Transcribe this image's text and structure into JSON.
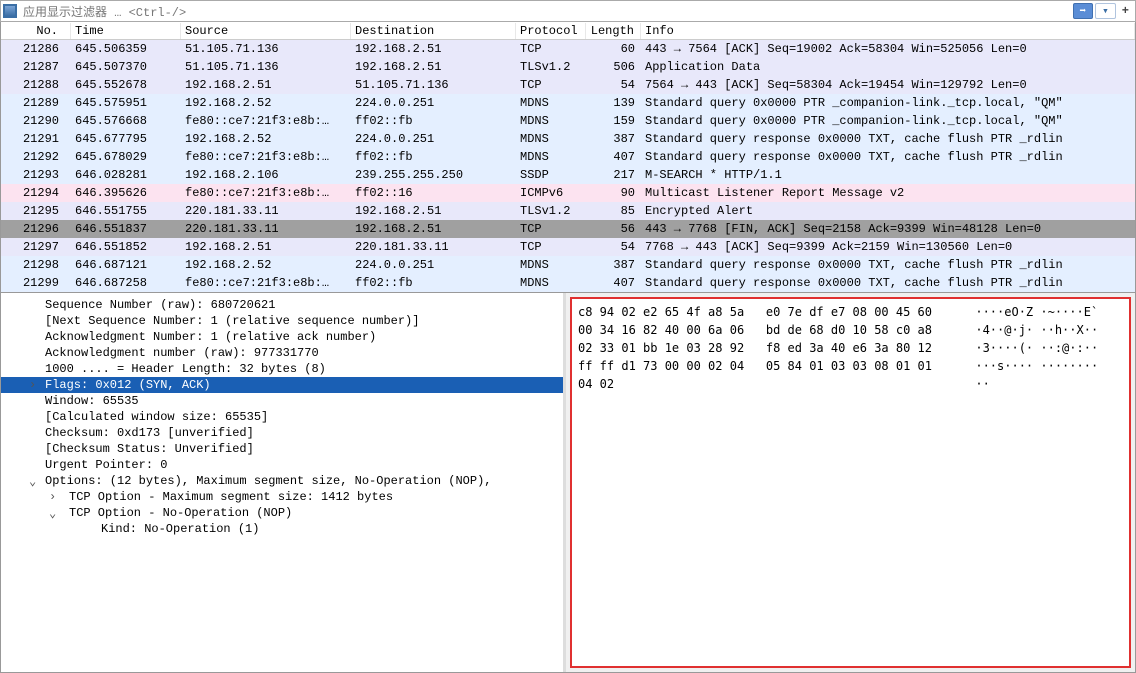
{
  "filter": {
    "placeholder": "应用显示过滤器 … <Ctrl-/>",
    "go_label": "➡",
    "add_label": "+"
  },
  "columns": {
    "no": "No.",
    "time": "Time",
    "source": "Source",
    "destination": "Destination",
    "protocol": "Protocol",
    "length": "Length",
    "info": "Info"
  },
  "packets": [
    {
      "no": "21286",
      "time": "645.506359",
      "src": "51.105.71.136",
      "dst": "192.168.2.51",
      "proto": "TCP",
      "len": "60",
      "info": "443 → 7564 [ACK] Seq=19002 Ack=58304 Win=525056 Len=0",
      "bg": "bg-light-purple"
    },
    {
      "no": "21287",
      "time": "645.507370",
      "src": "51.105.71.136",
      "dst": "192.168.2.51",
      "proto": "TLSv1.2",
      "len": "506",
      "info": "Application Data",
      "bg": "bg-light-purple"
    },
    {
      "no": "21288",
      "time": "645.552678",
      "src": "192.168.2.51",
      "dst": "51.105.71.136",
      "proto": "TCP",
      "len": "54",
      "info": "7564 → 443 [ACK] Seq=58304 Ack=19454 Win=129792 Len=0",
      "bg": "bg-light-purple"
    },
    {
      "no": "21289",
      "time": "645.575951",
      "src": "192.168.2.52",
      "dst": "224.0.0.251",
      "proto": "MDNS",
      "len": "139",
      "info": "Standard query 0x0000 PTR _companion-link._tcp.local, \"QM\"",
      "bg": "bg-light-blue"
    },
    {
      "no": "21290",
      "time": "645.576668",
      "src": "fe80::ce7:21f3:e8b:…",
      "dst": "ff02::fb",
      "proto": "MDNS",
      "len": "159",
      "info": "Standard query 0x0000 PTR _companion-link._tcp.local, \"QM\"",
      "bg": "bg-light-blue"
    },
    {
      "no": "21291",
      "time": "645.677795",
      "src": "192.168.2.52",
      "dst": "224.0.0.251",
      "proto": "MDNS",
      "len": "387",
      "info": "Standard query response 0x0000 TXT, cache flush PTR _rdlin",
      "bg": "bg-light-blue"
    },
    {
      "no": "21292",
      "time": "645.678029",
      "src": "fe80::ce7:21f3:e8b:…",
      "dst": "ff02::fb",
      "proto": "MDNS",
      "len": "407",
      "info": "Standard query response 0x0000 TXT, cache flush PTR _rdlin",
      "bg": "bg-light-blue"
    },
    {
      "no": "21293",
      "time": "646.028281",
      "src": "192.168.2.106",
      "dst": "239.255.255.250",
      "proto": "SSDP",
      "len": "217",
      "info": "M-SEARCH * HTTP/1.1",
      "bg": "bg-light-blue"
    },
    {
      "no": "21294",
      "time": "646.395626",
      "src": "fe80::ce7:21f3:e8b:…",
      "dst": "ff02::16",
      "proto": "ICMPv6",
      "len": "90",
      "info": "Multicast Listener Report Message v2",
      "bg": "bg-pink"
    },
    {
      "no": "21295",
      "time": "646.551755",
      "src": "220.181.33.11",
      "dst": "192.168.2.51",
      "proto": "TLSv1.2",
      "len": "85",
      "info": "Encrypted Alert",
      "bg": "bg-light-purple"
    },
    {
      "no": "21296",
      "time": "646.551837",
      "src": "220.181.33.11",
      "dst": "192.168.2.51",
      "proto": "TCP",
      "len": "56",
      "info": "443 → 7768 [FIN, ACK] Seq=2158 Ack=9399 Win=48128 Len=0",
      "bg": "bg-selected"
    },
    {
      "no": "21297",
      "time": "646.551852",
      "src": "192.168.2.51",
      "dst": "220.181.33.11",
      "proto": "TCP",
      "len": "54",
      "info": "7768 → 443 [ACK] Seq=9399 Ack=2159 Win=130560 Len=0",
      "bg": "bg-light-purple"
    },
    {
      "no": "21298",
      "time": "646.687121",
      "src": "192.168.2.52",
      "dst": "224.0.0.251",
      "proto": "MDNS",
      "len": "387",
      "info": "Standard query response 0x0000 TXT, cache flush PTR _rdlin",
      "bg": "bg-light-blue"
    },
    {
      "no": "21299",
      "time": "646.687258",
      "src": "fe80::ce7:21f3:e8b:…",
      "dst": "ff02::fb",
      "proto": "MDNS",
      "len": "407",
      "info": "Standard query response 0x0000 TXT, cache flush PTR _rdlin",
      "bg": "bg-light-blue"
    }
  ],
  "details": [
    {
      "text": "Sequence Number (raw): 680720621",
      "lvl": "lvl1"
    },
    {
      "text": "[Next Sequence Number: 1    (relative sequence number)]",
      "lvl": "lvl1"
    },
    {
      "text": "Acknowledgment Number: 1    (relative ack number)",
      "lvl": "lvl1"
    },
    {
      "text": "Acknowledgment number (raw): 977331770",
      "lvl": "lvl1"
    },
    {
      "text": "1000 .... = Header Length: 32 bytes (8)",
      "lvl": "lvl1"
    },
    {
      "text": "Flags: 0x012 (SYN, ACK)",
      "lvl": "lvl1",
      "exp": "›",
      "sel": true
    },
    {
      "text": "Window: 65535",
      "lvl": "lvl1"
    },
    {
      "text": "[Calculated window size: 65535]",
      "lvl": "lvl1"
    },
    {
      "text": "Checksum: 0xd173 [unverified]",
      "lvl": "lvl1"
    },
    {
      "text": "[Checksum Status: Unverified]",
      "lvl": "lvl1"
    },
    {
      "text": "Urgent Pointer: 0",
      "lvl": "lvl1"
    },
    {
      "text": "Options: (12 bytes), Maximum segment size, No-Operation (NOP),",
      "lvl": "lvl1",
      "exp": "⌄"
    },
    {
      "text": "TCP Option - Maximum segment size: 1412 bytes",
      "lvl": "lvl2",
      "exp": "›"
    },
    {
      "text": "TCP Option - No-Operation (NOP)",
      "lvl": "lvl2",
      "exp": "⌄"
    },
    {
      "text": "Kind: No-Operation (1)",
      "lvl": "lvl3"
    }
  ],
  "hex": {
    "l0": "c8 94 02 e2 65 4f a8 5a   e0 7e df e7 08 00 45 60      ····eO·Z ·~····E`",
    "l1": "00 34 16 82 40 00 6a 06   bd de 68 d0 10 58 c0 a8      ·4··@·j· ··h··X··",
    "l2": "02 33 01 bb 1e 03 28 92   f8 ed 3a 40 e6 3a 80 12      ·3····(· ··:@·:··",
    "l3": "ff ff d1 73 00 00 02 04   05 84 01 03 03 08 01 01      ···s···· ········",
    "l4": "04 02                                                  ··"
  }
}
